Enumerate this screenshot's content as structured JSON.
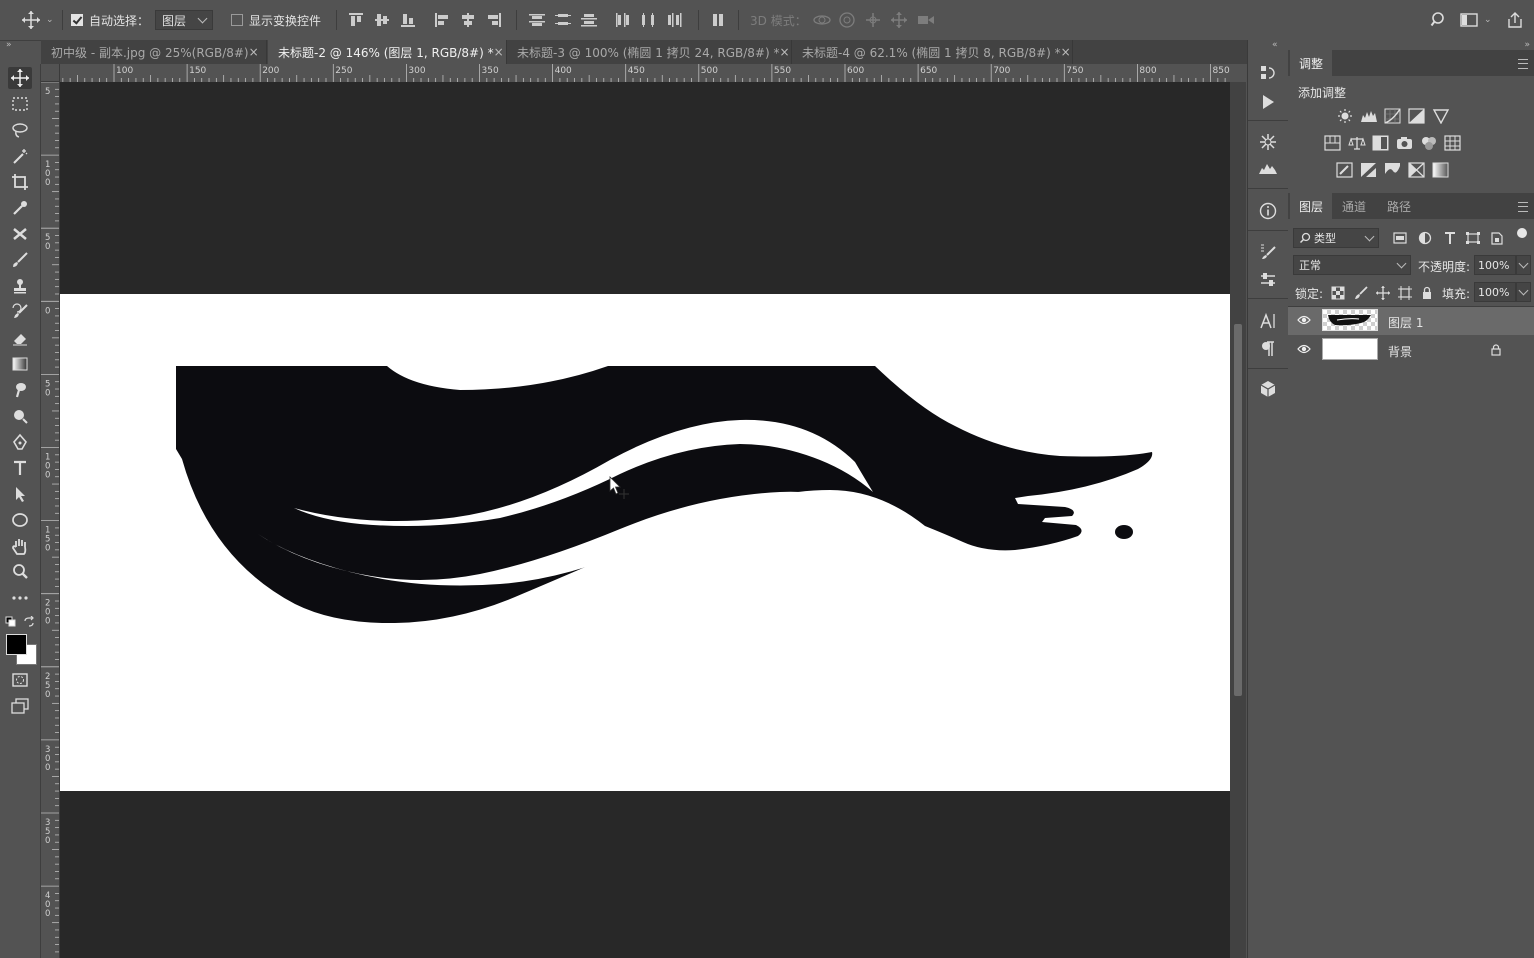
{
  "options_bar": {
    "auto_select_label": "自动选择：",
    "auto_select_target": "图层",
    "show_transform_label": "显示变换控件",
    "mode_3d_label": "3D 模式："
  },
  "tabs": [
    {
      "label": "初中级 - 副本.jpg @ 25%(RGB/8#)",
      "close": "×"
    },
    {
      "label": "未标题-2 @ 146% (图层 1, RGB/8#) *",
      "close": "×"
    },
    {
      "label": "未标题-3 @ 100% (椭圆 1 拷贝 24, RGB/8#) *",
      "close": "×"
    },
    {
      "label": "未标题-4 @ 62.1% (椭圆 1 拷贝 8, RGB/8#) *",
      "close": "×"
    }
  ],
  "ruler": {
    "h_ticks": [
      "100",
      "150",
      "200",
      "250",
      "300",
      "350",
      "400",
      "450",
      "500",
      "550",
      "600",
      "650",
      "700",
      "750",
      "800",
      "850"
    ],
    "v_ticks": [
      "5",
      "100",
      "50",
      "0",
      "50",
      "100",
      "150",
      "200",
      "250",
      "300",
      "350",
      "400"
    ]
  },
  "adjustments_panel": {
    "tab": "调整",
    "add_label": "添加调整"
  },
  "layers_panel": {
    "tabs": [
      "图层",
      "通道",
      "路径"
    ],
    "filter_kind": "类型",
    "blend_mode": "正常",
    "opacity_label": "不透明度:",
    "opacity_value": "100%",
    "lock_label": "锁定:",
    "fill_label": "填充:",
    "fill_value": "100%",
    "layers": [
      {
        "name": "图层 1",
        "selected": true,
        "visible": true,
        "locked": false
      },
      {
        "name": "背景",
        "selected": false,
        "visible": true,
        "locked": true
      }
    ]
  },
  "colors": {
    "foreground": "#000000",
    "background": "#ffffff",
    "canvas_bg": "#282828",
    "ui_gray": "#535353"
  }
}
